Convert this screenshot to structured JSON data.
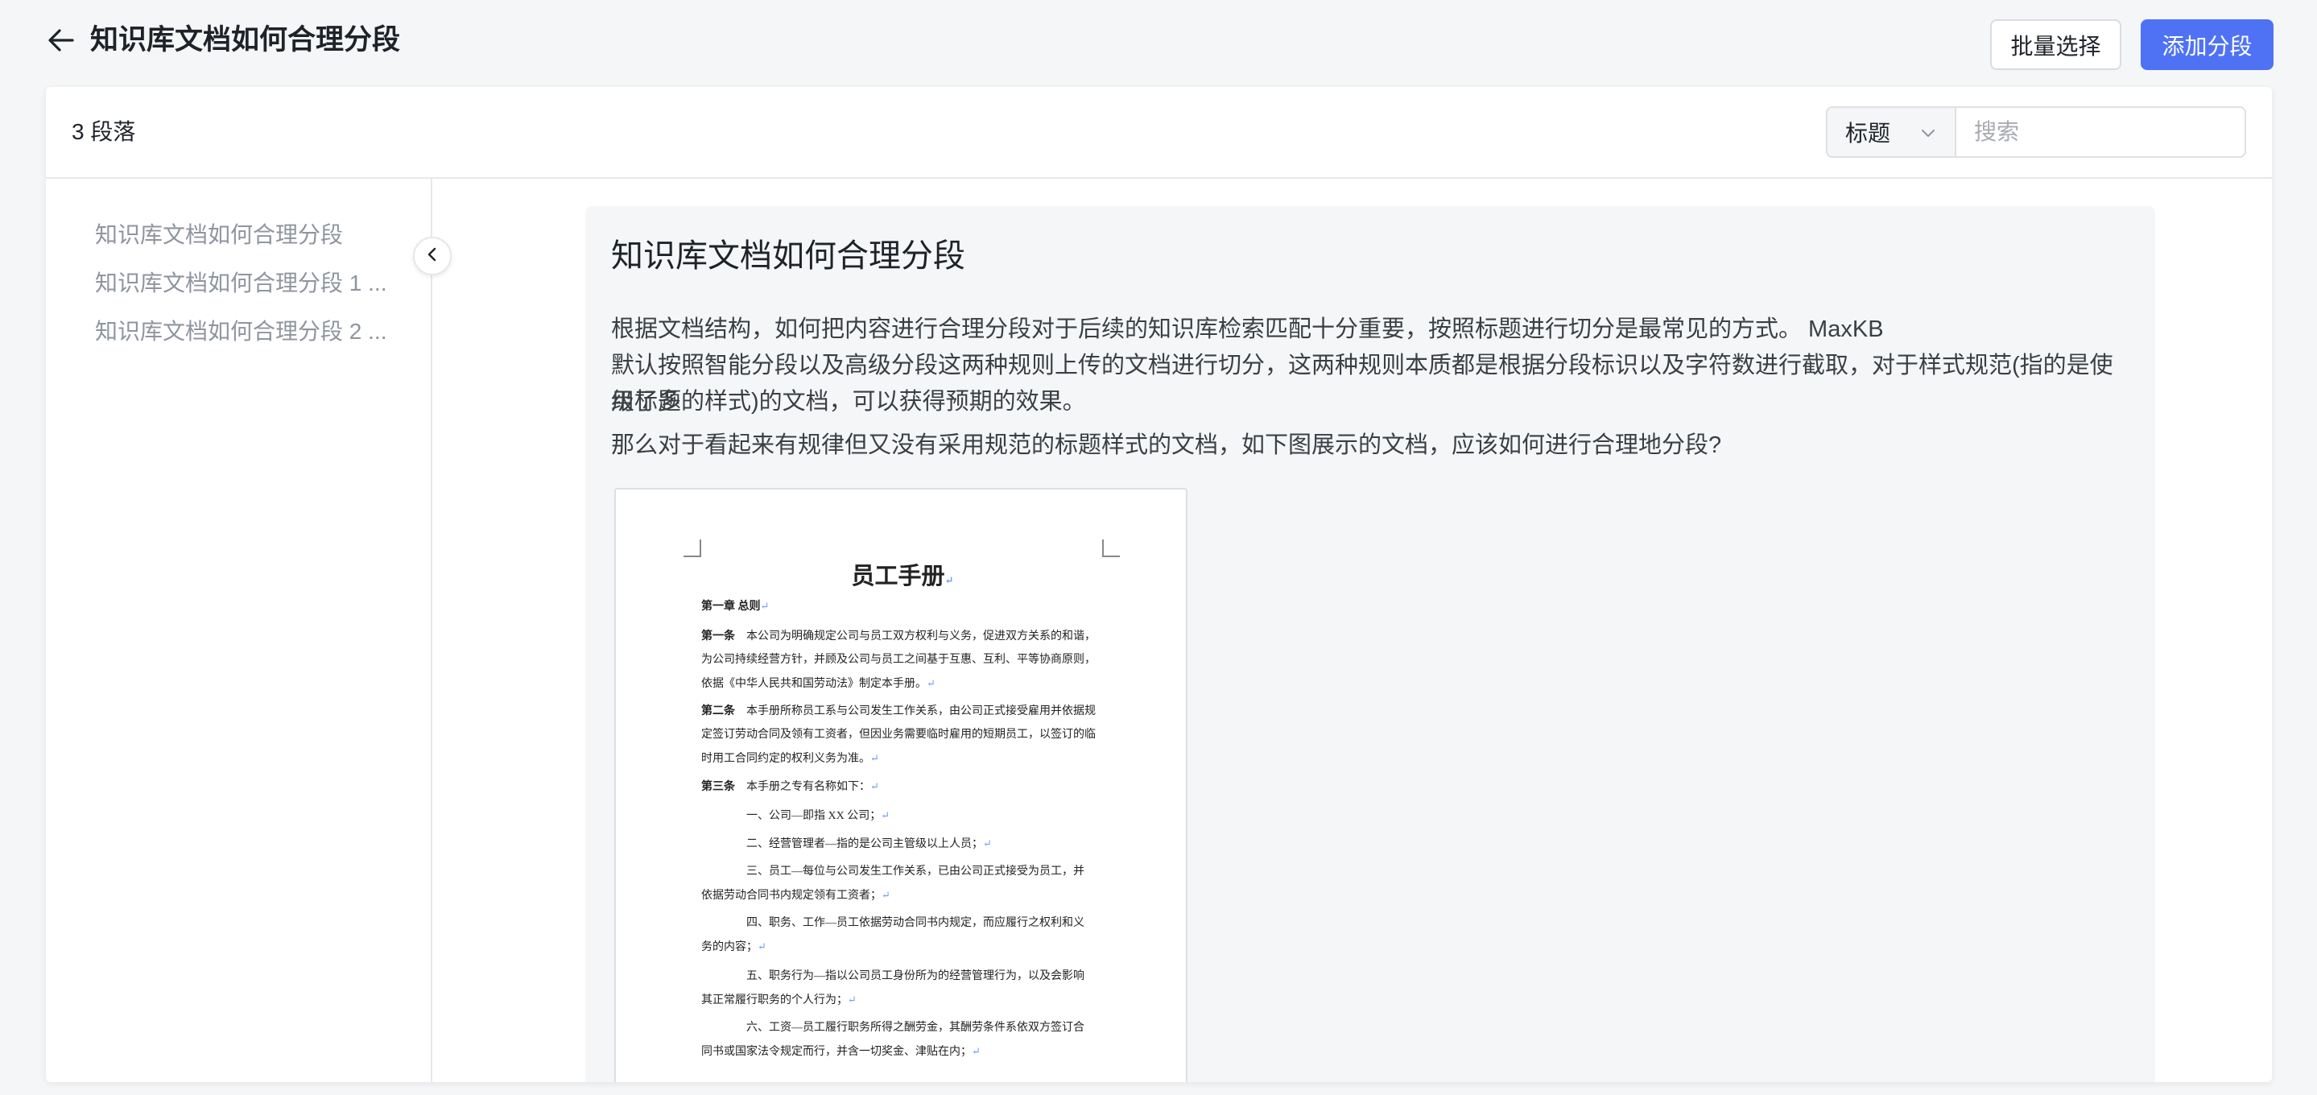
{
  "header": {
    "title": "知识库文档如何合理分段",
    "batch_select_label": "批量选择",
    "add_segment_label": "添加分段"
  },
  "toolbar": {
    "count_label": "3 段落",
    "filter_selected": "标题",
    "search_placeholder": "搜索"
  },
  "sidebar": {
    "items": [
      {
        "label": "知识库文档如何合理分段"
      },
      {
        "label": "知识库文档如何合理分段 1 ..."
      },
      {
        "label": "知识库文档如何合理分段 2 ..."
      }
    ]
  },
  "content": {
    "title": "知识库文档如何合理分段",
    "para1_line1": "根据文档结构，如何把内容进行合理分段对于后续的知识库检索匹配十分重要，按照标题进行切分是最常见的方式。 MaxKB",
    "para1_line2": "默认按照智能分段以及高级分段这两种规则上传的文档进行切分，这两种规则本质都是根据分段标识以及字符数进行截取，对于样式规范(指的是使用了多",
    "para1_line3": "级标题的样式)的文档，可以获得预期的效果。",
    "para2": "那么对于看起来有规律但又没有采用规范的标题样式的文档，如下图展示的文档，应该如何进行合理地分段?"
  },
  "document_image": {
    "title": "员工手册",
    "chapter": "第一章  总则",
    "lines": [
      {
        "bold": "第一条",
        "text": "　本公司为明确规定公司与员工双方权利与义务，促进双方关系的和谐，",
        "ret": false
      },
      {
        "bold": "",
        "text": "为公司持续经营方针，并顾及公司与员工之间基于互惠、互利、平等协商原则，",
        "ret": false
      },
      {
        "bold": "",
        "text": "依据《中华人民共和国劳动法》制定本手册。",
        "ret": true
      },
      {
        "bold": "第二条",
        "text": "　本手册所称员工系与公司发生工作关系，由公司正式接受雇用并依据规",
        "ret": false
      },
      {
        "bold": "",
        "text": "定签订劳动合同及领有工资者，但因业务需要临时雇用的短期员工，以签订的临",
        "ret": false
      },
      {
        "bold": "",
        "text": "时用工合同约定的权利义务为准。",
        "ret": true
      },
      {
        "bold": "第三条",
        "text": "　本手册之专有名称如下：",
        "ret": true
      },
      {
        "bold": "",
        "text": "　　　　一、公司—即指 XX 公司；",
        "ret": true
      },
      {
        "bold": "",
        "text": "　　　　二、经营管理者—指的是公司主管级以上人员；",
        "ret": true
      },
      {
        "bold": "",
        "text": "　　　　三、员工—每位与公司发生工作关系，已由公司正式接受为员工，并",
        "ret": false
      },
      {
        "bold": "",
        "text": "依据劳动合同书内规定领有工资者；",
        "ret": true
      },
      {
        "bold": "",
        "text": "　　　　四、职务、工作—员工依据劳动合同书内规定，而应履行之权利和义",
        "ret": false
      },
      {
        "bold": "",
        "text": "务的内容；",
        "ret": true
      },
      {
        "bold": "",
        "text": "　　　　五、职务行为—指以公司员工身份所为的经营管理行为，以及会影响",
        "ret": false
      },
      {
        "bold": "",
        "text": "其正常履行职务的个人行为；",
        "ret": true
      },
      {
        "bold": "",
        "text": "　　　　六、工资—员工履行职务所得之酬劳金，其酬劳条件系依双方签订合",
        "ret": false
      },
      {
        "bold": "",
        "text": "同书或国家法令规定而行，并含一切奖金、津贴在内；",
        "ret": true
      }
    ]
  }
}
